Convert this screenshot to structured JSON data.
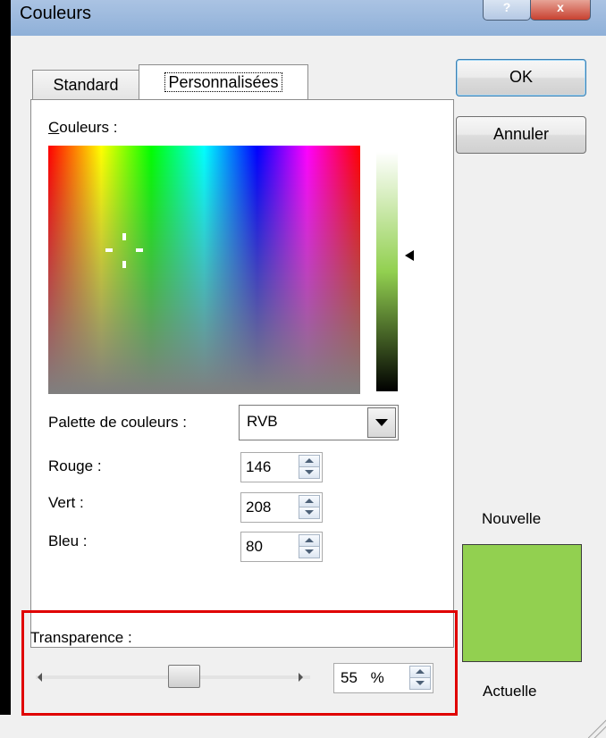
{
  "window": {
    "title": "Couleurs",
    "help_glyph": "?",
    "close_glyph": "x"
  },
  "tabs": [
    {
      "label": "Standard",
      "selected": false
    },
    {
      "label": "Personnalisées",
      "selected": true
    }
  ],
  "colors_label": "Couleurs :",
  "palette": {
    "label": "Palette de couleurs :",
    "value": "RVB"
  },
  "channels": [
    {
      "label": "Rouge :",
      "value": "146"
    },
    {
      "label": "Vert :",
      "value": "208"
    },
    {
      "label": "Bleu :",
      "value": "80"
    }
  ],
  "transparency": {
    "label": "Transparence :",
    "value": "55",
    "unit": "%",
    "fraction": 0.55
  },
  "buttons": {
    "ok": "OK",
    "cancel": "Annuler"
  },
  "preview": {
    "new_label": "Nouvelle",
    "current_label": "Actuelle",
    "new_color": "#92d050"
  },
  "colors": {
    "highlight": "#e00000",
    "accent_border": "#3c7fb1"
  },
  "icons": [
    "help-icon",
    "close-icon",
    "dropdown-arrow-icon",
    "spin-up-icon",
    "spin-down-icon",
    "luminance-arrow-icon",
    "crosshair-icon",
    "resize-grip-icon"
  ]
}
